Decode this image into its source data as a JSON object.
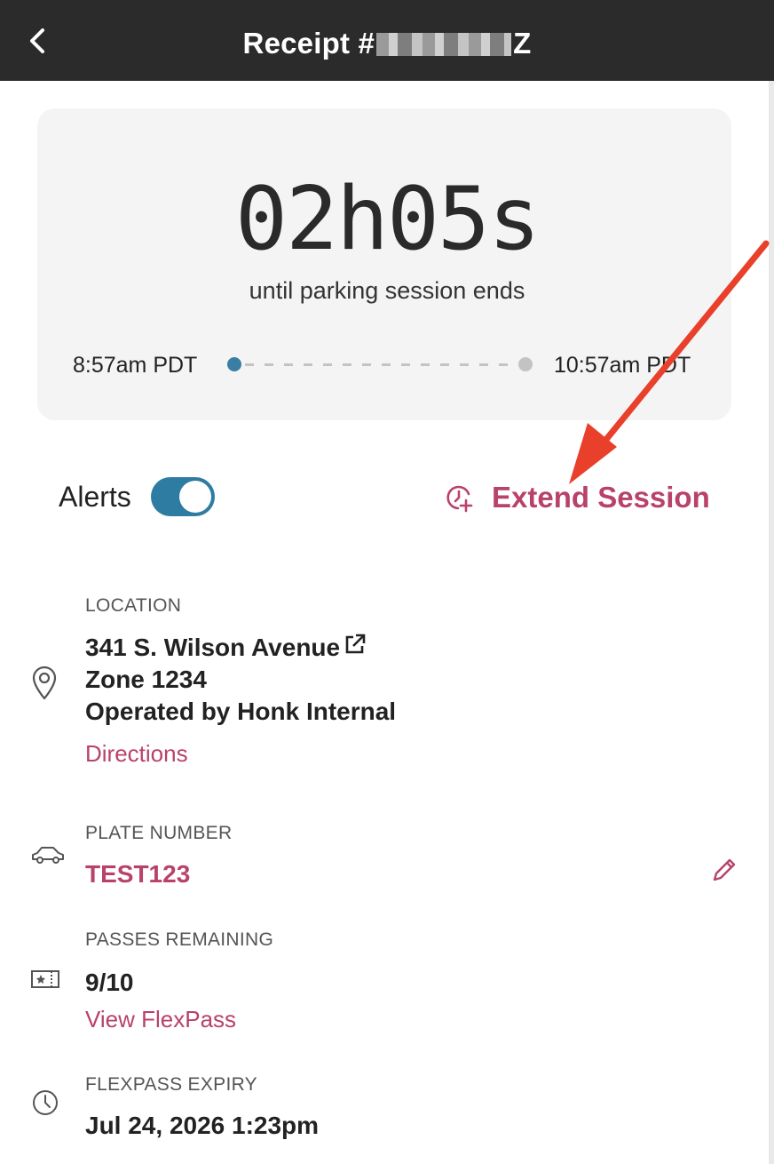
{
  "header": {
    "title_prefix": "Receipt #",
    "title_suffix": "Z"
  },
  "timer": {
    "remaining": "02h05s",
    "caption": "until parking session ends",
    "start_time": "8:57am PDT",
    "end_time": "10:57am PDT"
  },
  "controls": {
    "alerts_label": "Alerts",
    "alerts_on": true,
    "extend_label": "Extend Session"
  },
  "location": {
    "label": "LOCATION",
    "address": "341 S. Wilson Avenue",
    "zone": "Zone 1234",
    "operator": "Operated by Honk Internal",
    "directions_label": "Directions"
  },
  "plate": {
    "label": "PLATE NUMBER",
    "value": "TEST123"
  },
  "passes": {
    "label": "PASSES REMAINING",
    "value": "9/10",
    "link_label": "View FlexPass"
  },
  "expiry": {
    "label": "FLEXPASS EXPIRY",
    "value": "Jul 24, 2026 1:23pm"
  },
  "colors": {
    "accent": "#b8426b",
    "toggle": "#2f7ca3",
    "header_bg": "#2b2b2b",
    "annotation_arrow": "#e8402a"
  }
}
